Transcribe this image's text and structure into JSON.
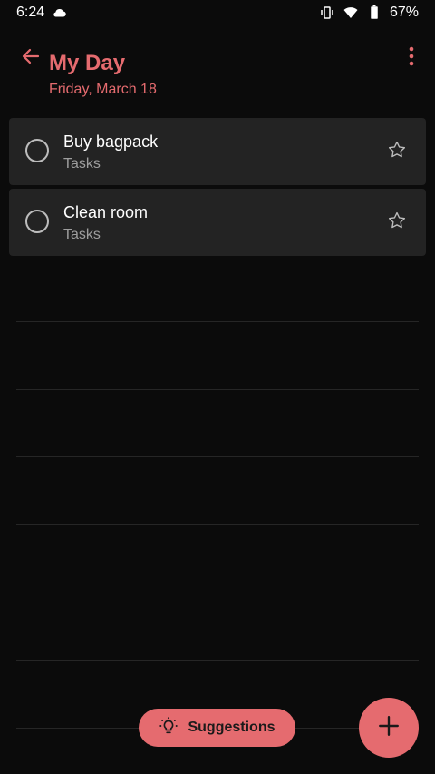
{
  "status_bar": {
    "time": "6:24",
    "battery": "67%"
  },
  "header": {
    "title": "My Day",
    "subtitle": "Friday, March 18"
  },
  "tasks": [
    {
      "title": "Buy bagpack",
      "list": "Tasks",
      "starred": false
    },
    {
      "title": "Clean room",
      "list": "Tasks",
      "starred": false
    }
  ],
  "bottom": {
    "suggestions_label": "Suggestions"
  },
  "colors": {
    "accent": "#e56b6f",
    "background": "#0b0b0b",
    "card": "#232323"
  },
  "icons": {
    "back": "arrow-left-icon",
    "menu": "more-vertical-icon",
    "check": "circle-outline-icon",
    "star": "star-outline-icon",
    "suggestions": "lightbulb-icon",
    "add": "plus-icon"
  }
}
